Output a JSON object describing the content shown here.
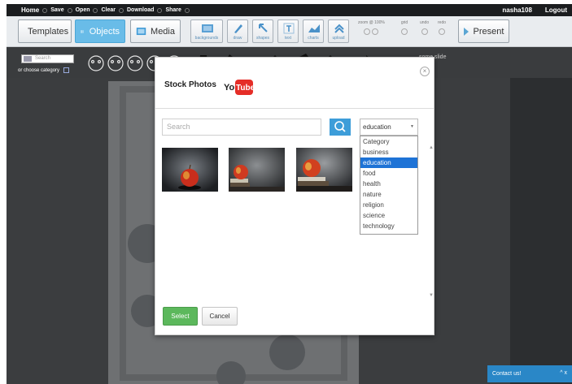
{
  "topbar": {
    "menu": [
      "Home",
      "Save",
      "Open",
      "Clear",
      "Download",
      "Share"
    ],
    "username": "nasha108",
    "logout_label": "Logout"
  },
  "toolbar": {
    "templates_label": "Templates",
    "objects_label": "Objects",
    "media_label": "Media",
    "tools": [
      {
        "label": "backgrounds",
        "icon": "background-icon"
      },
      {
        "label": "draw",
        "icon": "pencil-icon"
      },
      {
        "label": "shapes",
        "icon": "arrow-shape-icon"
      },
      {
        "label": "text",
        "icon": "text-icon"
      },
      {
        "label": "charts",
        "icon": "chart-icon"
      },
      {
        "label": "upload",
        "icon": "upload-icon"
      }
    ],
    "zoom_label": "zoom @ 100%",
    "grid_label": "grid",
    "undo_label": "undo",
    "redo_label": "redo",
    "present_label": "Present",
    "accent_color": "#69bce8"
  },
  "objects_strip": {
    "search_placeholder": "Search",
    "category_label": "or  choose category",
    "slide_label": "some slide"
  },
  "modal": {
    "tab_stock": "Stock Photos",
    "tab_youtube_you": "You",
    "tab_youtube_tube": "Tube",
    "search_placeholder": "Search",
    "selected_category": "education",
    "categories": [
      "Category",
      "business",
      "education",
      "food",
      "health",
      "nature",
      "religion",
      "science",
      "technology"
    ],
    "select_label": "Select",
    "cancel_label": "Cancel"
  },
  "contact": {
    "label": "Contact us!",
    "controls": "^ x"
  }
}
